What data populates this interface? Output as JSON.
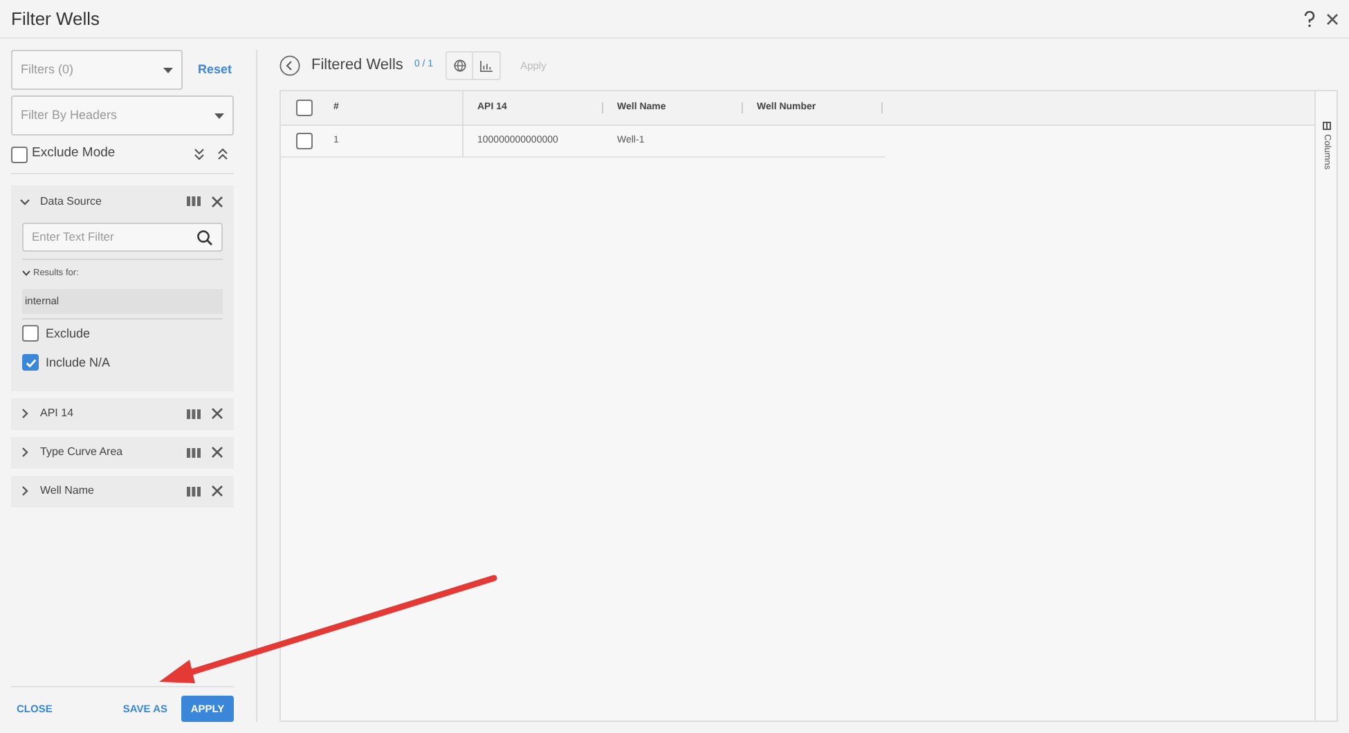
{
  "window": {
    "title": "Filter Wells"
  },
  "left": {
    "filters_select": {
      "placeholder": "Filters (0)"
    },
    "reset": "Reset",
    "headers_select": {
      "placeholder": "Filter By Headers"
    },
    "exclude_mode": {
      "label": "Exclude Mode",
      "checked": false
    },
    "groups": [
      {
        "title": "Data Source",
        "expanded": true,
        "search": {
          "placeholder": "Enter Text Filter"
        },
        "results_label": "Results for:",
        "results": [
          "internal"
        ],
        "options": [
          {
            "label": "Exclude",
            "checked": false
          },
          {
            "label": "Include N/A",
            "checked": true
          }
        ]
      },
      {
        "title": "API 14",
        "expanded": false
      },
      {
        "title": "Type Curve Area",
        "expanded": false
      },
      {
        "title": "Well Name",
        "expanded": false
      }
    ],
    "footer": {
      "close": "CLOSE",
      "save_as": "SAVE AS",
      "apply": "APPLY"
    }
  },
  "right": {
    "title": "Filtered Wells",
    "count": "0 / 1",
    "apply": "Apply",
    "table": {
      "columns": [
        "#",
        "API 14",
        "Well Name",
        "Well Number"
      ],
      "select_all": false,
      "rows": [
        {
          "checked": false,
          "cells": [
            "1",
            "100000000000000",
            "Well-1",
            ""
          ]
        }
      ]
    },
    "side_tab": "Columns"
  }
}
